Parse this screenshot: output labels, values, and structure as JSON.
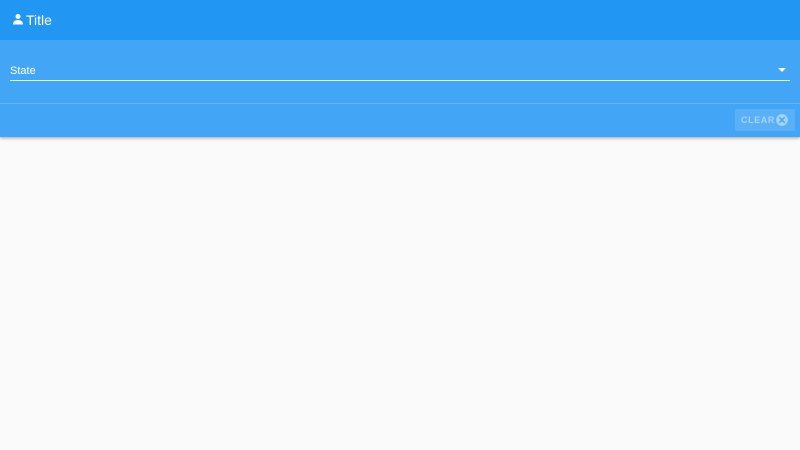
{
  "header": {
    "title": "Title",
    "icon": "person-icon",
    "background": "#2196f3"
  },
  "filter_panel": {
    "background": "#42a5f5",
    "state_select": {
      "label": "State",
      "selected_value": "",
      "icon": "chevron-down-icon"
    },
    "clear_button": {
      "label": "CLEAR",
      "icon": "close-circle-icon",
      "enabled": false
    }
  },
  "page_background": "#fafafa"
}
